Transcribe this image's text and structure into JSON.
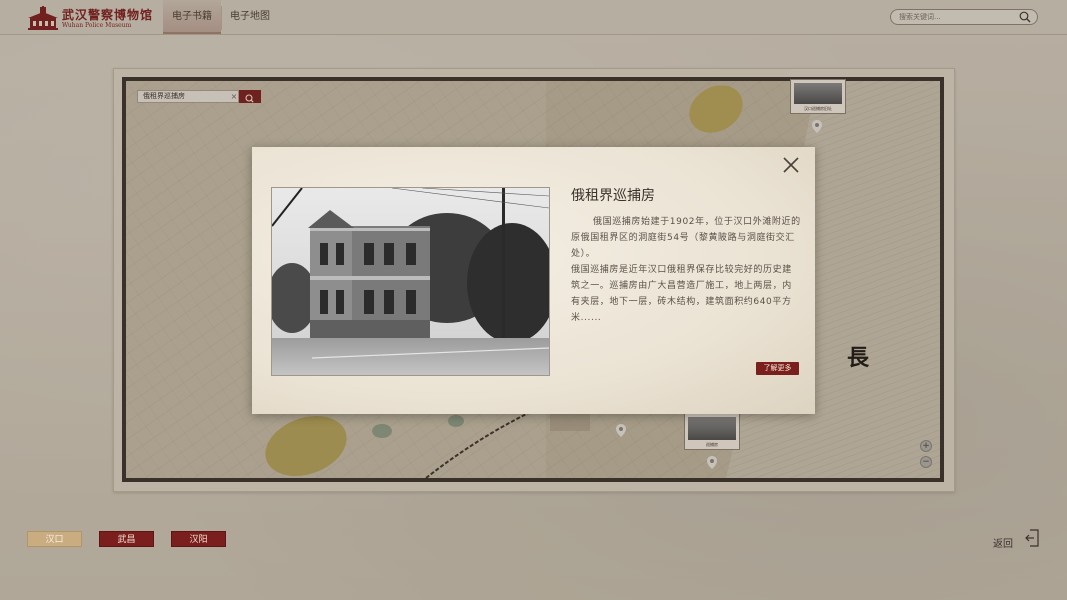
{
  "header": {
    "logo_cn": "武汉警察博物馆",
    "logo_en": "Wuhan Police Museum",
    "tabs": [
      {
        "label": "电子书籍",
        "active": true
      },
      {
        "label": "电子地图",
        "active": false
      }
    ],
    "search_placeholder": "搜索关键词..."
  },
  "map": {
    "search_value": "俄租界巡捕房",
    "search_clear": "×",
    "thumbs": [
      {
        "caption": "汉口巡捕房旧址"
      },
      {
        "caption": "巡捕房"
      }
    ],
    "map_char": "長",
    "zoom_in": "+",
    "zoom_out": "−"
  },
  "modal": {
    "title": "俄租界巡捕房",
    "paragraphs": [
      "俄国巡捕房始建于1902年，位于汉口外滩附近的原俄国租界区的洞庭街54号（黎黄陂路与洞庭街交汇处）。",
      "俄国巡捕房是近年汉口俄租界保存比较完好的历史建筑之一。巡捕房由广大昌营造厂施工，地上两层，内有夹层，地下一层，砖木结构，建筑面积约640平方米......"
    ],
    "learn_more": "了解更多"
  },
  "districts": [
    {
      "label": "汉口",
      "active": true
    },
    {
      "label": "武昌",
      "active": false
    },
    {
      "label": "汉阳",
      "active": false
    }
  ],
  "back_label": "返回",
  "colors": {
    "accent_red": "#7a1e1e",
    "active_gold": "#c9ad80",
    "frame_dark": "#3a312b"
  }
}
